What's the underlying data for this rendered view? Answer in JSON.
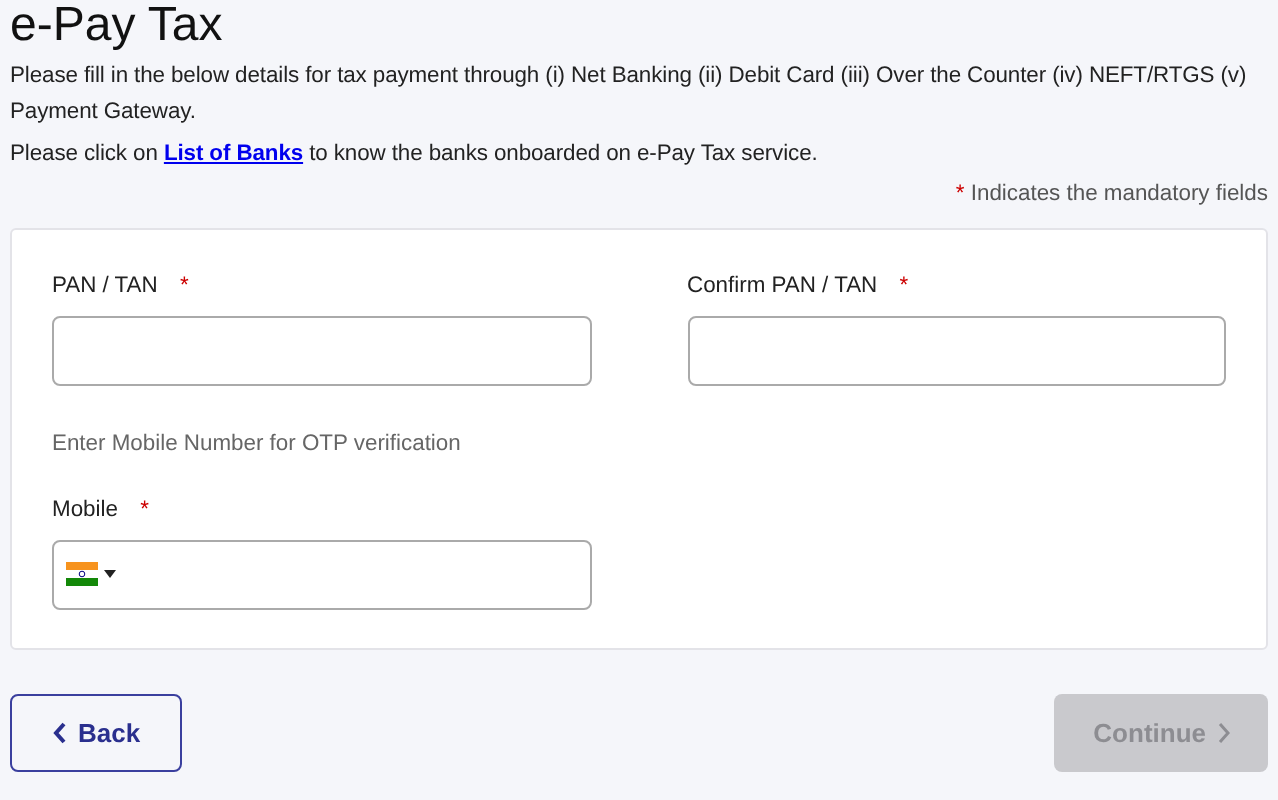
{
  "title": "e-Pay Tax",
  "intro": "Please fill in the below details for tax payment through (i) Net Banking (ii) Debit Card (iii) Over the Counter (iv) NEFT/RTGS (v) Payment Gateway.",
  "bank_note": {
    "before": "Please click on",
    "link": "List of Banks",
    "after": "to know the banks onboarded on e-Pay Tax service."
  },
  "mandatory_note": {
    "mark": "*",
    "text": "Indicates the mandatory fields"
  },
  "fields": [
    {
      "kind": "text",
      "label": "PAN / TAN",
      "required": true
    },
    {
      "kind": "text",
      "label": "Confirm PAN / TAN",
      "required": true
    },
    {
      "kind": "hint",
      "text": "Enter Mobile Number for OTP verification"
    },
    {
      "kind": "phone",
      "label": "Mobile",
      "required": true
    }
  ],
  "buttons": [
    {
      "kind": "back",
      "label": "Back"
    },
    {
      "kind": "continue",
      "label": "Continue",
      "disabled": true
    }
  ]
}
